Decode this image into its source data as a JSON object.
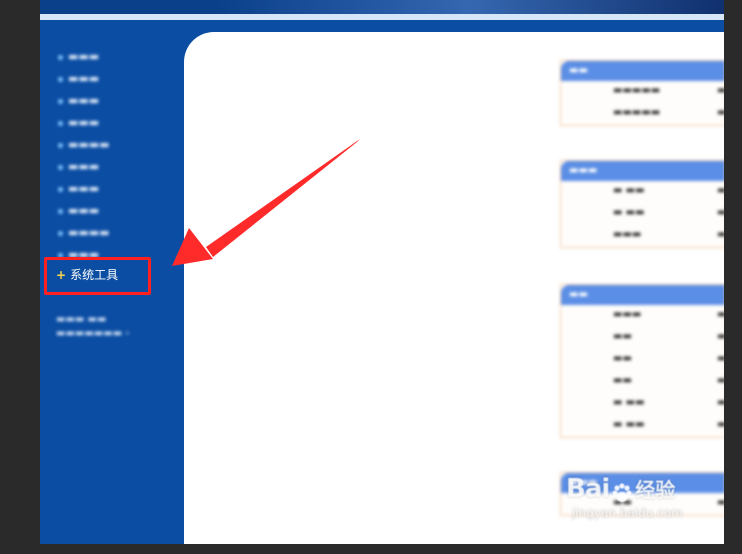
{
  "sidebar": {
    "highlighted_item": {
      "label": "系统工具"
    }
  },
  "watermark": {
    "brand_left": "Bai",
    "brand_right": "经验",
    "url": "jingyan.baidu.com"
  },
  "colors": {
    "frame_blue": "#0b4da3",
    "panel_header": "#5b8ee6",
    "highlight_red": "#ff2020",
    "plus_yellow": "#ffd84a"
  }
}
